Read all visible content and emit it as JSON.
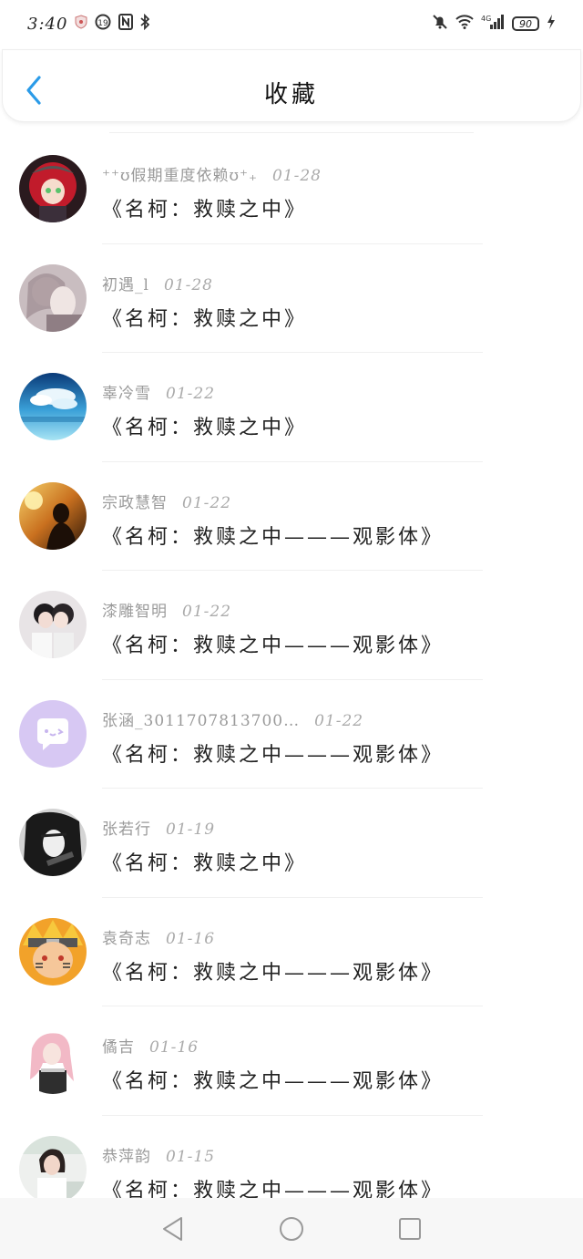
{
  "status_bar": {
    "time": "3:40",
    "battery": "90",
    "network": "4G"
  },
  "header": {
    "title": "收藏"
  },
  "items": [
    {
      "author": "⁺⁺ʊ假期重度依赖ʊ⁺₊",
      "date": "01-28",
      "title": "《名柯：救赎之中》",
      "avatar": "red-hair-anime-avatar"
    },
    {
      "author": "初遇_l",
      "date": "01-28",
      "title": "《名柯：救赎之中》",
      "avatar": "pale-anime-avatar"
    },
    {
      "author": "辜冷雪",
      "date": "01-22",
      "title": "《名柯：救赎之中》",
      "avatar": "sky-clouds-avatar"
    },
    {
      "author": "宗政慧智",
      "date": "01-22",
      "title": "《名柯：救赎之中———观影体》",
      "avatar": "sunset-silhouette-avatar"
    },
    {
      "author": "漆雕智明",
      "date": "01-22",
      "title": "《名柯：救赎之中———观影体》",
      "avatar": "couple-photo-avatar"
    },
    {
      "author": "张涵_3011707813700…",
      "date": "01-22",
      "title": "《名柯：救赎之中———观影体》",
      "avatar": "default-chat-avatar"
    },
    {
      "author": "张若行",
      "date": "01-19",
      "title": "《名柯：救赎之中》",
      "avatar": "dark-anime-avatar"
    },
    {
      "author": "袁奇志",
      "date": "01-16",
      "title": "《名柯：救赎之中———观影体》",
      "avatar": "naruto-avatar"
    },
    {
      "author": "僪吉",
      "date": "01-16",
      "title": "《名柯：救赎之中———观影体》",
      "avatar": "pink-hair-avatar"
    },
    {
      "author": "恭萍韵",
      "date": "01-15",
      "title": "《名柯：救赎之中———观影体》",
      "avatar": "girl-photo-avatar"
    }
  ],
  "colors": {
    "accent": "#2b9be8",
    "text": "#222222",
    "meta": "#9a9a9a"
  }
}
